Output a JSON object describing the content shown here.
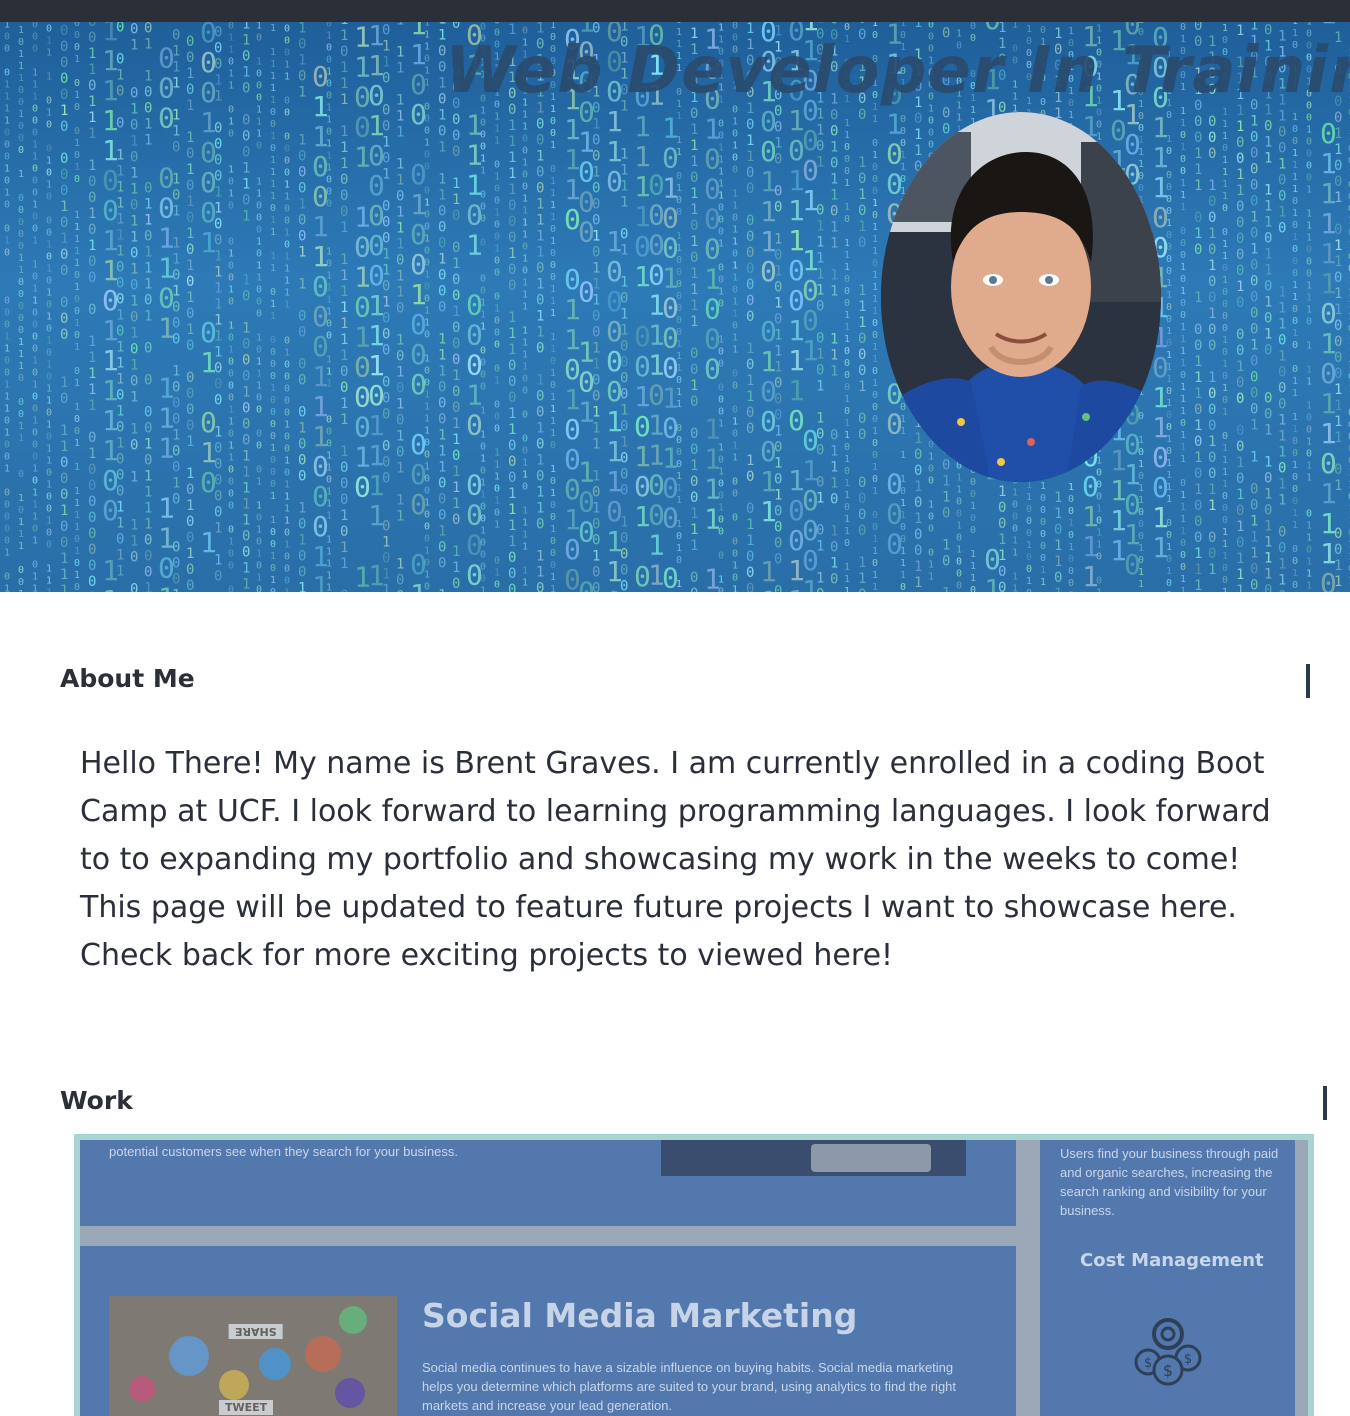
{
  "hero": {
    "title": "Web Developer In Training",
    "avatar_alt": "Profile photo"
  },
  "about": {
    "heading": "About Me",
    "text": "Hello There! My name is Brent Graves. I am currently enrolled in a coding Boot Camp at UCF. I look forward to learning programming languages. I look forward to to expanding my portfolio and showcasing my work in the weeks to come! This page will be updated to feature future projects I want to showcase here. Check back for more exciting projects to viewed here!"
  },
  "work": {
    "heading": "Work",
    "preview": {
      "top_text": "potential customers see when they search for your business.",
      "sidebar_text": "Users find your business through paid and organic searches, increasing the search ranking and visibility for your business.",
      "cost_title": "Cost Management",
      "smm_title": "Social Media Marketing",
      "smm_text": "Social media continues to have a sizable influence on buying habits. Social media marketing helps you determine which platforms are suited to your brand, using analytics to find the right markets and increase your lead generation.",
      "image_labels": [
        "SHARE",
        "TWEET"
      ]
    }
  },
  "colors": {
    "topbar": "#2b2f38",
    "hero_blue": "#2d7ab6",
    "text": "#2a2f3a",
    "work_border": "#a8d5cf",
    "panel": "#5278ae"
  }
}
